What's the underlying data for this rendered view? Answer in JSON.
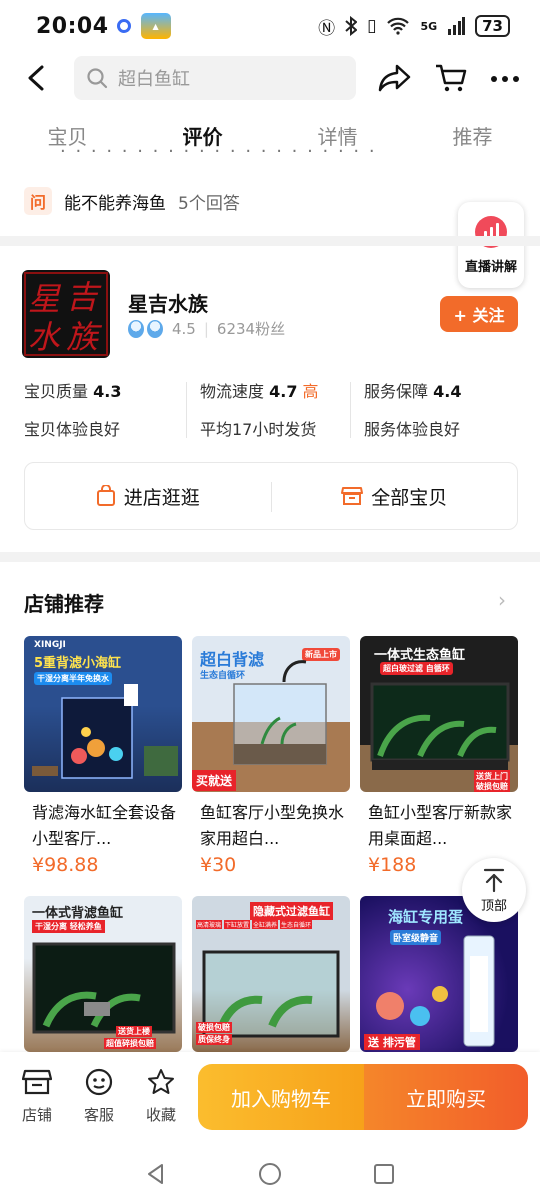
{
  "status_bar": {
    "time": "20:04",
    "network": "5G",
    "battery": "73"
  },
  "header": {
    "search_placeholder": "超白鱼缸"
  },
  "tabs": [
    {
      "label": "宝贝",
      "active": false
    },
    {
      "label": "评价",
      "active": true
    },
    {
      "label": "详情",
      "active": false
    },
    {
      "label": "推荐",
      "active": false
    }
  ],
  "qa": {
    "badge": "问",
    "question": "能不能养海鱼",
    "answers": "5个回答"
  },
  "live_button": {
    "label": "直播讲解"
  },
  "shop": {
    "logo_text": [
      "星",
      "吉",
      "水",
      "族"
    ],
    "name": "星吉水族",
    "rating": "4.5",
    "fans": "6234粉丝",
    "follow_label": "+ 关注",
    "metrics": [
      {
        "key": "宝贝质量",
        "score": "4.3",
        "flag": "",
        "desc": "宝贝体验良好"
      },
      {
        "key": "物流速度",
        "score": "4.7",
        "flag": "高",
        "desc": "平均17小时发货"
      },
      {
        "key": "服务保障",
        "score": "4.4",
        "flag": "",
        "desc": "服务体验良好"
      }
    ],
    "enter_label": "进店逛逛",
    "all_items_label": "全部宝贝"
  },
  "recommend": {
    "title": "店铺推荐",
    "more": "›",
    "products": [
      {
        "title": "背滤海水缸全套设备小型客厅...",
        "price": "¥98.88",
        "tags": [
          "XINGJI",
          "5重背滤小海缸",
          "干湿分离半年免换水"
        ]
      },
      {
        "title": "鱼缸客厅小型免换水家用超白...",
        "price": "¥30",
        "tags": [
          "超白背滤",
          "生态自循环",
          "买就送",
          "新品上市"
        ]
      },
      {
        "title": "鱼缸小型客厅新款家用桌面超...",
        "price": "¥188",
        "tags": [
          "一体式生态鱼缸",
          "超白玻过滤 自循环",
          "送货上门",
          "破损包赔"
        ]
      },
      {
        "title": "",
        "price": "",
        "tags": [
          "一体式背滤鱼缸",
          "干湿分离 轻松养鱼",
          "送货上楼",
          "超值碎损包赔"
        ]
      },
      {
        "title": "",
        "price": "",
        "tags": [
          "隐藏式过滤鱼缸",
          "高清玻璃",
          "下缸放置",
          "全缸满养",
          "生态自循环",
          "破损包赔",
          "质保终身"
        ]
      },
      {
        "title": "",
        "price": "",
        "tags": [
          "海缸专用蛋",
          "卧室级静音",
          "送 排污管"
        ]
      }
    ]
  },
  "top_button": {
    "label": "顶部"
  },
  "bottom_bar": {
    "items": [
      {
        "label": "店铺",
        "icon": "store-icon"
      },
      {
        "label": "客服",
        "icon": "service-icon"
      },
      {
        "label": "收藏",
        "icon": "star-icon"
      }
    ],
    "cart_label": "加入购物车",
    "buy_label": "立即购买"
  },
  "colors": {
    "accent": "#f26b2a",
    "cart": "#f7a11a",
    "buy": "#f25d2a"
  }
}
